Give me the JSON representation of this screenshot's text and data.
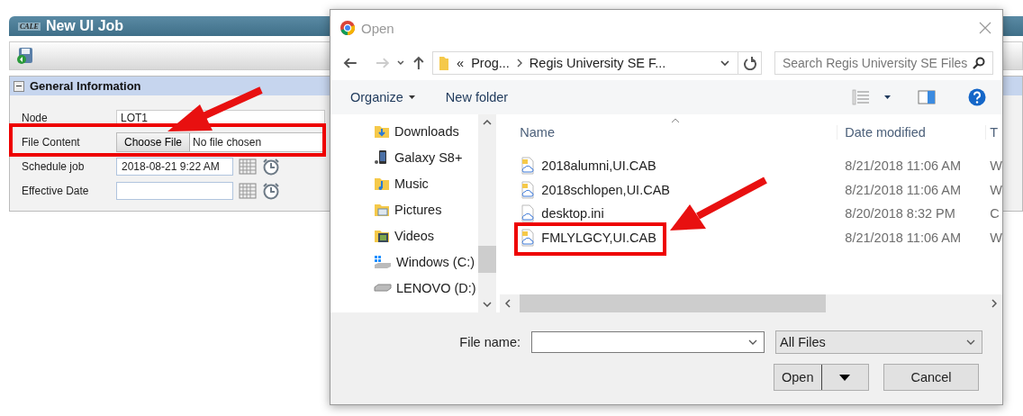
{
  "page": {
    "logo": "CALE",
    "title": "New UI Job",
    "section": {
      "title": "General Information",
      "expanded": true
    },
    "fields": [
      {
        "label": "Node",
        "kind": "text",
        "value": "LOT1"
      },
      {
        "label": "File Content",
        "kind": "file",
        "button": "Choose File",
        "value": "No file chosen"
      },
      {
        "label": "Schedule job",
        "kind": "datetime",
        "value": "2018-08-21 9:22 AM"
      },
      {
        "label": "Effective Date",
        "kind": "datetime"
      }
    ]
  },
  "dialog": {
    "title": "Open",
    "address": {
      "overflow": "«",
      "path": [
        "Prog...",
        "Regis University SE F..."
      ]
    },
    "search": {
      "placeholder": "Search Regis University SE Files"
    },
    "toolbar": {
      "organize": "Organize",
      "new_folder": "New folder"
    },
    "nav_pane": [
      {
        "label": "Downloads",
        "kind": "downloads"
      },
      {
        "label": "Galaxy S8+",
        "kind": "phone"
      },
      {
        "label": "Music",
        "kind": "music"
      },
      {
        "label": "Pictures",
        "kind": "pictures"
      },
      {
        "label": "Videos",
        "kind": "videos"
      },
      {
        "label": "Windows (C:)",
        "kind": "system-drive"
      },
      {
        "label": "LENOVO (D:)",
        "kind": "drive"
      }
    ],
    "columns": [
      "Name",
      "Date modified",
      "T"
    ],
    "files": [
      {
        "name": "2018alumni,UI.CAB",
        "date": "8/21/2018 11:06 AM",
        "column_3": "W",
        "kind": "cab"
      },
      {
        "name": "2018schlopen,UI.CAB",
        "date": "8/21/2018 11:06 AM",
        "column_3": "W",
        "kind": "cab"
      },
      {
        "name": "desktop.ini",
        "date": "8/20/2018 8:32 PM",
        "column_3": "C",
        "kind": "ini"
      },
      {
        "name": "FMLYLGCY,UI.CAB",
        "date": "8/21/2018 11:06 AM",
        "column_3": "W",
        "kind": "cab"
      }
    ],
    "file_name_label": "File name:",
    "file_type": "All Files",
    "buttons": [
      "Open",
      "Cancel"
    ]
  }
}
